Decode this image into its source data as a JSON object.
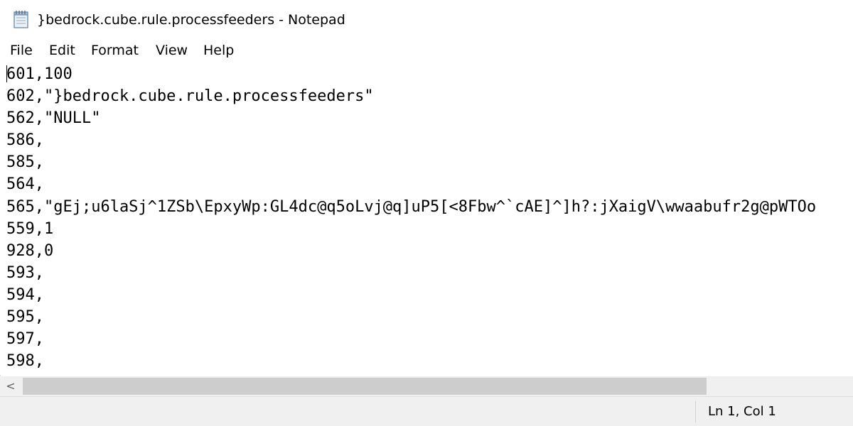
{
  "window": {
    "title": "}bedrock.cube.rule.processfeeders - Notepad",
    "app_icon": "notepad-icon"
  },
  "menu": {
    "items": [
      {
        "label": "File"
      },
      {
        "label": "Edit"
      },
      {
        "label": "Format"
      },
      {
        "label": "View"
      },
      {
        "label": "Help"
      }
    ]
  },
  "editor": {
    "lines": [
      "601,100",
      "602,\"}bedrock.cube.rule.processfeeders\"",
      "562,\"NULL\"",
      "586,",
      "585,",
      "564,",
      "565,\"gEj;u6laSj^1ZSb\\EpxyWp:GL4dc@q5oLvj@q]uP5[<8Fbw^`cAE]^]h?:jXaigV\\wwaabufr2g@pWTOo",
      "559,1",
      "928,0",
      "593,",
      "594,",
      "595,",
      "597,",
      "598,"
    ]
  },
  "scrollbar": {
    "left_arrow": "<"
  },
  "status": {
    "position": "Ln 1, Col 1"
  },
  "colors": {
    "chrome": "#f0f0f0",
    "scroll_thumb": "#cdcdcd",
    "text": "#000000"
  }
}
